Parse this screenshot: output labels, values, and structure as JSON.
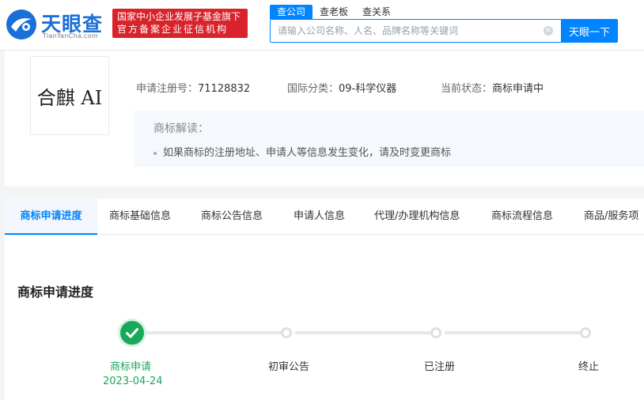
{
  "header": {
    "logo_title": "天眼查",
    "logo_domain": "TianYanCha.com",
    "badge_line1": "国家中小企业发展子基金旗下",
    "badge_line2": "官方备案企业征信机构",
    "search_tabs": [
      "查公司",
      "查老板",
      "查关系"
    ],
    "search_placeholder": "请输入公司名称、人名、品牌名称等关键词",
    "search_button": "天眼一下",
    "clear_symbol": "×"
  },
  "trademark": {
    "image_text": "合麒 AI",
    "reg_no_label": "申请注册号：",
    "reg_no": "71128832",
    "class_label": "国际分类：",
    "class_value": "09-科学仪器",
    "status_label": "当前状态：",
    "status_value": "商标申请中",
    "explain_title": "商标解读：",
    "explain_item": "如果商标的注册地址、申请人等信息发生变化，请及时变更商标"
  },
  "tabs": [
    "商标申请进度",
    "商标基础信息",
    "商标公告信息",
    "申请人信息",
    "代理/办理机构信息",
    "商标流程信息",
    "商品/服务项"
  ],
  "progress": {
    "title": "商标申请进度",
    "steps": [
      {
        "label": "商标申请",
        "date": "2023-04-24",
        "done": true
      },
      {
        "label": "初审公告",
        "done": false
      },
      {
        "label": "已注册",
        "done": false
      },
      {
        "label": "终止",
        "done": false
      }
    ]
  },
  "colors": {
    "brand_blue": "#0084ff",
    "badge_red": "#d9232c",
    "done_green": "#1aa85b"
  }
}
